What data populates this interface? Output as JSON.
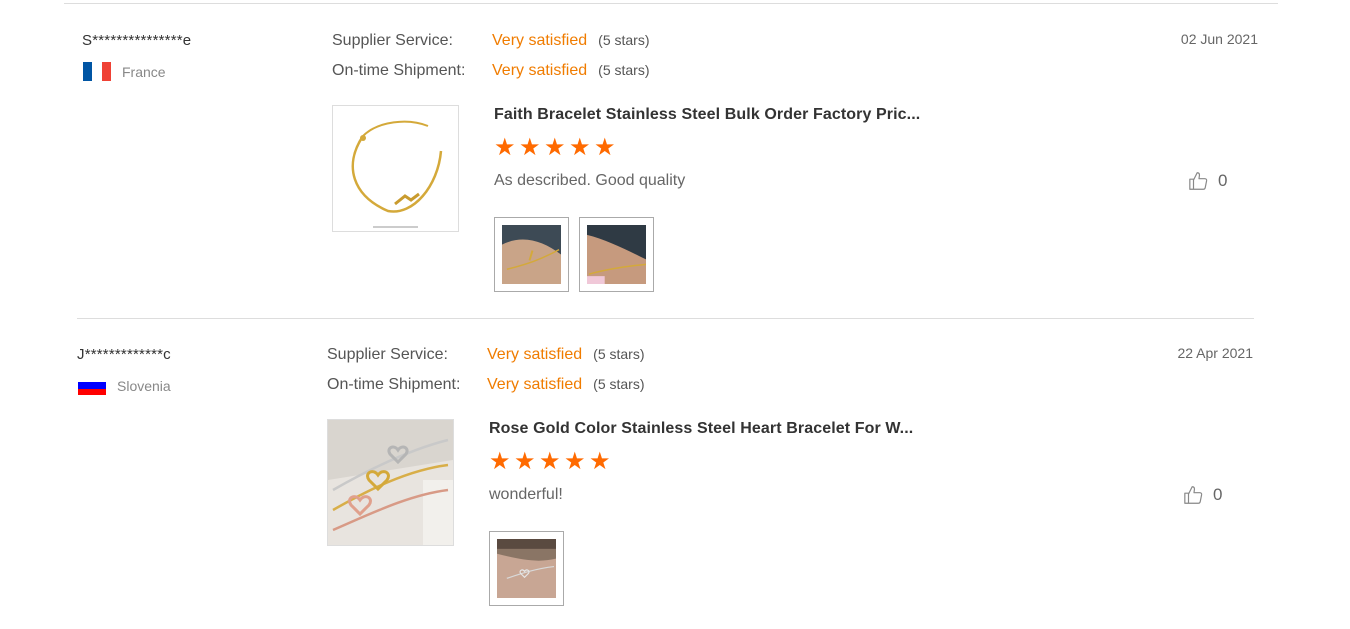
{
  "reviews": [
    {
      "reviewer": "S***************e",
      "country": "France",
      "supplier_service_label": "Supplier Service:",
      "supplier_service_value": "Very satisfied",
      "supplier_service_stars": "(5 stars)",
      "shipment_label": "On-time Shipment:",
      "shipment_value": "Very satisfied",
      "shipment_stars": "(5 stars)",
      "date": "02 Jun 2021",
      "product_title": "Faith Bracelet Stainless Steel Bulk Order Factory Pric...",
      "rating": 5,
      "comment": "As described. Good quality",
      "likes": "0",
      "flag_colors": [
        "#0055a4",
        "#ffffff",
        "#ef4135"
      ],
      "photo_count": 2
    },
    {
      "reviewer": "J*************c",
      "country": "Slovenia",
      "supplier_service_label": "Supplier Service:",
      "supplier_service_value": "Very satisfied",
      "supplier_service_stars": "(5 stars)",
      "shipment_label": "On-time Shipment:",
      "shipment_value": "Very satisfied",
      "shipment_stars": "(5 stars)",
      "date": "22 Apr 2021",
      "product_title": "Rose Gold Color Stainless Steel Heart Bracelet For W...",
      "rating": 5,
      "comment": "wonderful!",
      "likes": "0",
      "flag_colors": [
        "#ffffff",
        "#0000ff",
        "#ff0000"
      ],
      "photo_count": 1
    }
  ],
  "icons": {
    "star": "star-icon",
    "like": "thumbs-up-icon"
  },
  "colors": {
    "accent": "#f07c00",
    "star": "#ff6a00"
  }
}
